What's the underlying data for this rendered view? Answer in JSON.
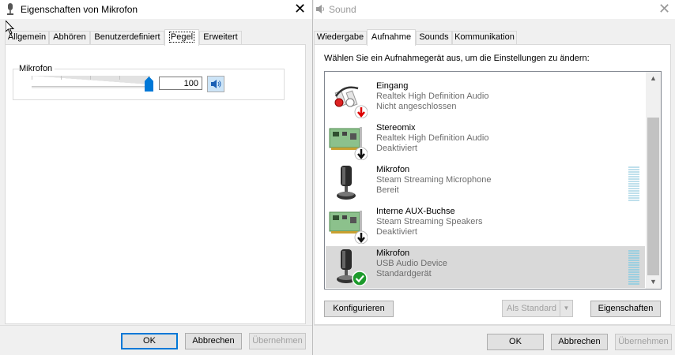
{
  "left": {
    "title": "Eigenschaften von Mikrofon",
    "tabs": [
      "Allgemein",
      "Abhören",
      "Benutzerdefiniert",
      "Pegel",
      "Erweitert"
    ],
    "active_tab": "Pegel",
    "group_label": "Mikrofon",
    "level_value": "100",
    "level_percent": 100,
    "buttons": {
      "ok": "OK",
      "cancel": "Abbrechen",
      "apply": "Übernehmen"
    }
  },
  "right": {
    "title": "Sound",
    "tabs": [
      "Wiedergabe",
      "Aufnahme",
      "Sounds",
      "Kommunikation"
    ],
    "active_tab": "Aufnahme",
    "instruction": "Wählen Sie ein Aufnahmegerät aus, um die Einstellungen zu ändern:",
    "devices": [
      {
        "name": "Eingang",
        "sub": "Realtek High Definition Audio",
        "status": "Nicht angeschlossen",
        "icon": "jack-icon",
        "badge": "red-down-arrow"
      },
      {
        "name": "Stereomix",
        "sub": "Realtek High Definition Audio",
        "status": "Deaktiviert",
        "icon": "soundcard-icon",
        "badge": "black-down-arrow"
      },
      {
        "name": "Mikrofon",
        "sub": "Steam Streaming Microphone",
        "status": "Bereit",
        "icon": "microphone-icon",
        "badge": "none"
      },
      {
        "name": "Interne AUX-Buchse",
        "sub": "Steam Streaming Speakers",
        "status": "Deaktiviert",
        "icon": "soundcard-icon",
        "badge": "black-down-arrow"
      },
      {
        "name": "Mikrofon",
        "sub": "USB Audio Device",
        "status": "Standardgerät",
        "icon": "microphone-icon",
        "badge": "green-check",
        "selected": true
      }
    ],
    "buttons": {
      "configure": "Konfigurieren",
      "set_default": "Als Standard",
      "properties": "Eigenschaften",
      "ok": "OK",
      "cancel": "Abbrechen",
      "apply": "Übernehmen"
    }
  },
  "colors": {
    "accent": "#0078d7",
    "selection": "#d9d9d9",
    "disabled_text": "#a0a0a0"
  }
}
